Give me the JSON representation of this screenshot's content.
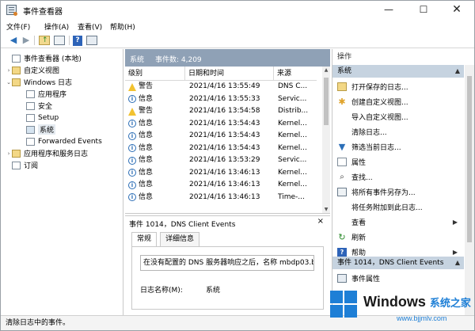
{
  "window": {
    "title": "事件查看器",
    "controls": {
      "minimize": "—",
      "maximize": "☐",
      "close": "✕"
    }
  },
  "menu": [
    "文件(F)",
    "操作(A)",
    "查看(V)",
    "帮助(H)"
  ],
  "tree": {
    "items": [
      {
        "label": "事件查看器 (本地)",
        "expanded": null
      },
      {
        "label": "自定义视图",
        "expanded": false
      },
      {
        "label": "Windows 日志",
        "expanded": true
      },
      {
        "label": "应用程序"
      },
      {
        "label": "安全"
      },
      {
        "label": "Setup"
      },
      {
        "label": "系统",
        "selected": true
      },
      {
        "label": "Forwarded Events"
      },
      {
        "label": "应用程序和服务日志",
        "expanded": false
      },
      {
        "label": "订阅"
      }
    ]
  },
  "events": {
    "header_title": "系统",
    "header_count": "事件数: 4,209",
    "columns": [
      "级别",
      "日期和时间",
      "来源"
    ],
    "rows": [
      {
        "level": "警告",
        "icon": "warning-icon",
        "date": "2021/4/16 13:55:49",
        "source": "DNS C..."
      },
      {
        "level": "信息",
        "icon": "info-icon",
        "date": "2021/4/16 13:55:33",
        "source": "Servic..."
      },
      {
        "level": "警告",
        "icon": "warning-icon",
        "date": "2021/4/16 13:54:58",
        "source": "Distrib..."
      },
      {
        "level": "信息",
        "icon": "info-icon",
        "date": "2021/4/16 13:54:43",
        "source": "Kernel..."
      },
      {
        "level": "信息",
        "icon": "info-icon",
        "date": "2021/4/16 13:54:43",
        "source": "Kernel..."
      },
      {
        "level": "信息",
        "icon": "info-icon",
        "date": "2021/4/16 13:54:43",
        "source": "Kernel..."
      },
      {
        "level": "信息",
        "icon": "info-icon",
        "date": "2021/4/16 13:53:29",
        "source": "Servic..."
      },
      {
        "level": "信息",
        "icon": "info-icon",
        "date": "2021/4/16 13:46:13",
        "source": "Kernel..."
      },
      {
        "level": "信息",
        "icon": "info-icon",
        "date": "2021/4/16 13:46:13",
        "source": "Kernel..."
      },
      {
        "level": "信息",
        "icon": "info-icon",
        "date": "2021/4/16 13:46:13",
        "source": "Time-..."
      }
    ]
  },
  "detail": {
    "title": "事件 1014，DNS Client Events",
    "close": "×",
    "tabs": [
      "常规",
      "详细信息"
    ],
    "message": "在没有配置的 DNS 服务器响应之后，名称 mbdp03.b",
    "log_name_label": "日志名称(M):",
    "log_name_value": "系统"
  },
  "actions": {
    "header": "操作",
    "group1": "系统",
    "items1": [
      {
        "label": "打开保存的日志...",
        "icon": "folder-open-icon"
      },
      {
        "label": "创建自定义视图...",
        "icon": "star-filter-icon"
      },
      {
        "label": "导入自定义视图...",
        "icon": ""
      },
      {
        "label": "清除日志...",
        "icon": ""
      },
      {
        "label": "筛选当前日志...",
        "icon": "funnel-icon"
      },
      {
        "label": "属性",
        "icon": "properties-icon"
      },
      {
        "label": "查找...",
        "icon": "find-icon"
      },
      {
        "label": "将所有事件另存为...",
        "icon": "save-icon"
      },
      {
        "label": "将任务附加到此日志...",
        "icon": ""
      },
      {
        "label": "查看",
        "icon": "",
        "submenu": true
      },
      {
        "label": "刷新",
        "icon": "refresh-icon"
      },
      {
        "label": "帮助",
        "icon": "help-icon",
        "submenu": true
      }
    ],
    "group2": "事件 1014，DNS Client Events",
    "items2": [
      {
        "label": "事件属性",
        "icon": "event-properties-icon"
      }
    ]
  },
  "status": "清除日志中的事件。",
  "watermark": {
    "brand": "Windows",
    "cn": "系统之家",
    "url": "www.bjjmlv.com"
  },
  "colors": {
    "header_bg": "#8fa1b6",
    "group_bg": "#c6d3e0",
    "accent": "#1e7fd6"
  }
}
